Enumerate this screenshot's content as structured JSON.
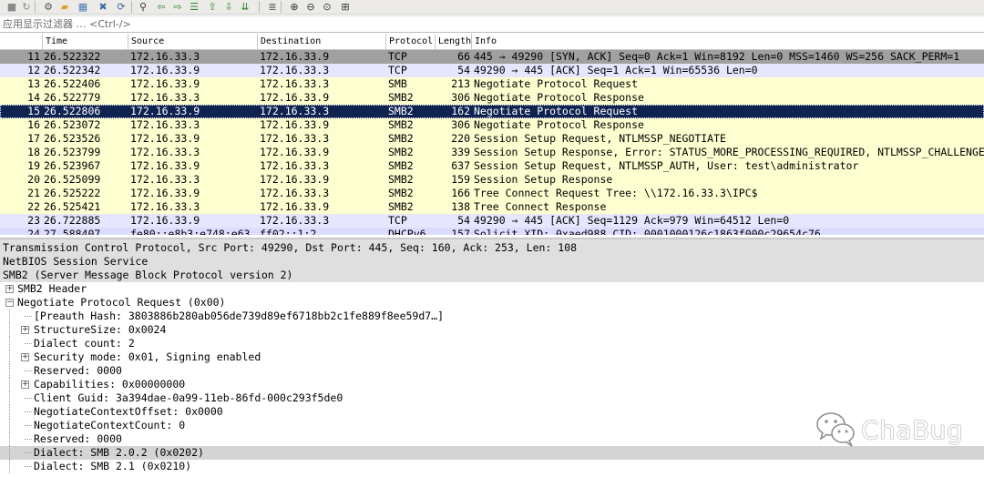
{
  "toolbar": {
    "buttons": [
      {
        "name": "stop-capture",
        "glyph": "■",
        "color": "#8a8a8a"
      },
      {
        "name": "restart-capture",
        "glyph": "↻",
        "color": "#8a8a8a"
      },
      {
        "name": "capture-options",
        "glyph": "⚙",
        "color": "#555555"
      },
      {
        "name": "open-file",
        "glyph": "▰",
        "color": "#e0a030"
      },
      {
        "name": "save-file",
        "glyph": "▦",
        "color": "#4a7ab5"
      },
      {
        "name": "close-file",
        "glyph": "✖",
        "color": "#3a6aa5"
      },
      {
        "name": "reload-file",
        "glyph": "⟳",
        "color": "#3a6aa5"
      },
      {
        "name": "find-packet",
        "glyph": "⚲",
        "color": "#333333"
      },
      {
        "name": "go-back",
        "glyph": "⇦",
        "color": "#2f8a2f"
      },
      {
        "name": "go-forward",
        "glyph": "⇨",
        "color": "#2f8a2f"
      },
      {
        "name": "go-to-packet",
        "glyph": "☰",
        "color": "#2f8a2f"
      },
      {
        "name": "go-first",
        "glyph": "⇧",
        "color": "#2f8a2f"
      },
      {
        "name": "go-last",
        "glyph": "⇩",
        "color": "#2f8a2f"
      },
      {
        "name": "auto-scroll",
        "glyph": "⇊",
        "color": "#2f8a2f"
      },
      {
        "name": "colorize",
        "glyph": "≣",
        "color": "#555555"
      },
      {
        "name": "zoom-in",
        "glyph": "⊕",
        "color": "#333333"
      },
      {
        "name": "zoom-out",
        "glyph": "⊖",
        "color": "#333333"
      },
      {
        "name": "zoom-normal",
        "glyph": "⊙",
        "color": "#333333"
      },
      {
        "name": "resize-columns",
        "glyph": "⊞",
        "color": "#333333"
      }
    ]
  },
  "filter": {
    "placeholder": "应用显示过滤器 … <Ctrl-/>"
  },
  "packet_list": {
    "columns": [
      "",
      "Time",
      "Source",
      "Destination",
      "Protocol",
      "Length",
      "Info"
    ],
    "rows": [
      {
        "no": "11",
        "time": "26.522322",
        "src": "172.16.33.3",
        "dst": "172.16.33.9",
        "proto": "TCP",
        "len": "66",
        "info": "445 → 49290 [SYN, ACK] Seq=0 Ack=1 Win=8192 Len=0 MSS=1460 WS=256 SACK_PERM=1",
        "bg": "#a0a0a0",
        "fg": "#000000"
      },
      {
        "no": "12",
        "time": "26.522342",
        "src": "172.16.33.9",
        "dst": "172.16.33.3",
        "proto": "TCP",
        "len": "54",
        "info": "49290 → 445 [ACK] Seq=1 Ack=1 Win=65536 Len=0",
        "bg": "#e7e6ff",
        "fg": "#000000"
      },
      {
        "no": "13",
        "time": "26.522406",
        "src": "172.16.33.9",
        "dst": "172.16.33.3",
        "proto": "SMB",
        "len": "213",
        "info": "Negotiate Protocol Request",
        "bg": "#feffd0",
        "fg": "#000000"
      },
      {
        "no": "14",
        "time": "26.522779",
        "src": "172.16.33.3",
        "dst": "172.16.33.9",
        "proto": "SMB2",
        "len": "306",
        "info": "Negotiate Protocol Response",
        "bg": "#feffd0",
        "fg": "#000000"
      },
      {
        "no": "15",
        "time": "26.522806",
        "src": "172.16.33.9",
        "dst": "172.16.33.3",
        "proto": "SMB2",
        "len": "162",
        "info": "Negotiate Protocol Request",
        "bg": "#0f2350",
        "fg": "#ffffff",
        "selected": true
      },
      {
        "no": "16",
        "time": "26.523072",
        "src": "172.16.33.3",
        "dst": "172.16.33.9",
        "proto": "SMB2",
        "len": "306",
        "info": "Negotiate Protocol Response",
        "bg": "#feffd0",
        "fg": "#000000"
      },
      {
        "no": "17",
        "time": "26.523526",
        "src": "172.16.33.9",
        "dst": "172.16.33.3",
        "proto": "SMB2",
        "len": "220",
        "info": "Session Setup Request, NTLMSSP_NEGOTIATE",
        "bg": "#feffd0",
        "fg": "#000000"
      },
      {
        "no": "18",
        "time": "26.523799",
        "src": "172.16.33.3",
        "dst": "172.16.33.9",
        "proto": "SMB2",
        "len": "339",
        "info": "Session Setup Response, Error: STATUS_MORE_PROCESSING_REQUIRED, NTLMSSP_CHALLENGE",
        "bg": "#feffd0",
        "fg": "#000000"
      },
      {
        "no": "19",
        "time": "26.523967",
        "src": "172.16.33.9",
        "dst": "172.16.33.3",
        "proto": "SMB2",
        "len": "637",
        "info": "Session Setup Request, NTLMSSP_AUTH, User: test\\administrator",
        "bg": "#feffd0",
        "fg": "#000000"
      },
      {
        "no": "20",
        "time": "26.525099",
        "src": "172.16.33.3",
        "dst": "172.16.33.9",
        "proto": "SMB2",
        "len": "159",
        "info": "Session Setup Response",
        "bg": "#feffd0",
        "fg": "#000000"
      },
      {
        "no": "21",
        "time": "26.525222",
        "src": "172.16.33.9",
        "dst": "172.16.33.3",
        "proto": "SMB2",
        "len": "166",
        "info": "Tree Connect Request Tree: \\\\172.16.33.3\\IPC$",
        "bg": "#feffd0",
        "fg": "#000000"
      },
      {
        "no": "22",
        "time": "26.525421",
        "src": "172.16.33.3",
        "dst": "172.16.33.9",
        "proto": "SMB2",
        "len": "138",
        "info": "Tree Connect Response",
        "bg": "#feffd0",
        "fg": "#000000"
      },
      {
        "no": "23",
        "time": "26.722885",
        "src": "172.16.33.9",
        "dst": "172.16.33.3",
        "proto": "TCP",
        "len": "54",
        "info": "49290 → 445 [ACK] Seq=1129 Ack=979 Win=64512 Len=0",
        "bg": "#e7e6ff",
        "fg": "#000000"
      },
      {
        "no": "24",
        "time": "27.588407",
        "src": "fe80::e8b3:e748:e63",
        "dst": "ff02::1:2",
        "proto": "DHCPv6",
        "len": "157",
        "info": "Solicit XID: 0xaed988 CID: 0001000126c1863f000c29654c76",
        "bg": "#dcdcff",
        "fg": "#000000",
        "partial": true
      }
    ]
  },
  "details": {
    "rows": [
      {
        "indent": 0,
        "expander": "none",
        "text": "Transmission Control Protocol, Src Port: 49290, Dst Port: 445, Seq: 160, Ack: 253, Len: 108",
        "bg": "#dfdfdf"
      },
      {
        "indent": 0,
        "expander": "none",
        "text": "NetBIOS Session Service",
        "bg": "#dfdfdf"
      },
      {
        "indent": 0,
        "expander": "none",
        "text": "SMB2 (Server Message Block Protocol version 2)",
        "bg": "#dfdfdf"
      },
      {
        "indent": 0,
        "expander": "plus",
        "text": "SMB2 Header",
        "bg": "#ffffff"
      },
      {
        "indent": 0,
        "expander": "minus",
        "text": "Negotiate Protocol Request (0x00)",
        "bg": "#ffffff"
      },
      {
        "indent": 1,
        "expander": "none",
        "text": "[Preauth Hash: 3803886b280ab056de739d89ef6718bb2c1fe889f8ee59d7…]",
        "bg": "#ffffff"
      },
      {
        "indent": 1,
        "expander": "plus",
        "text": "StructureSize: 0x0024",
        "bg": "#ffffff"
      },
      {
        "indent": 1,
        "expander": "none",
        "text": "Dialect count: 2",
        "bg": "#ffffff"
      },
      {
        "indent": 1,
        "expander": "plus",
        "text": "Security mode: 0x01, Signing enabled",
        "bg": "#ffffff"
      },
      {
        "indent": 1,
        "expander": "none",
        "text": "Reserved: 0000",
        "bg": "#ffffff"
      },
      {
        "indent": 1,
        "expander": "plus",
        "text": "Capabilities: 0x00000000",
        "bg": "#ffffff"
      },
      {
        "indent": 1,
        "expander": "none",
        "text": "Client Guid: 3a394dae-0a99-11eb-86fd-000c293f5de0",
        "bg": "#ffffff"
      },
      {
        "indent": 1,
        "expander": "none",
        "text": "NegotiateContextOffset: 0x0000",
        "bg": "#ffffff"
      },
      {
        "indent": 1,
        "expander": "none",
        "text": "NegotiateContextCount: 0",
        "bg": "#ffffff"
      },
      {
        "indent": 1,
        "expander": "none",
        "text": "Reserved: 0000",
        "bg": "#ffffff"
      },
      {
        "indent": 1,
        "expander": "none",
        "text": "Dialect: SMB 2.0.2 (0x0202)",
        "bg": "#d4d4d4",
        "selected": true
      },
      {
        "indent": 1,
        "expander": "none",
        "text": "Dialect: SMB 2.1 (0x0210)",
        "bg": "#ffffff"
      }
    ]
  },
  "watermark": {
    "text": "ChaBug",
    "icon": "wechat-icon"
  }
}
